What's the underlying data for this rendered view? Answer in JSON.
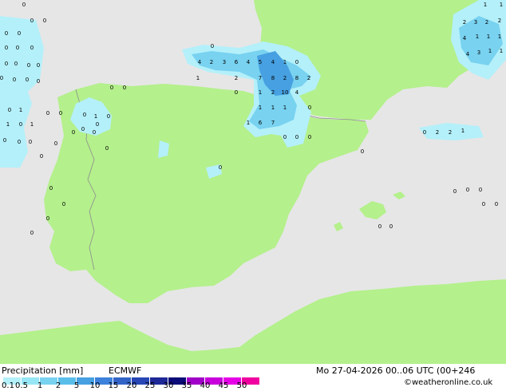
{
  "legend": {
    "title": "Precipitation [mm]",
    "model": "ECMWF",
    "datetime": "Mo 27-04-2026 00..06 UTC (00+246",
    "credit": "©weatheronline.co.uk",
    "ticks": [
      "0.1",
      "0.5",
      "1",
      "2",
      "5",
      "10",
      "15",
      "20",
      "25",
      "30",
      "35",
      "40",
      "45",
      "50"
    ],
    "colors": [
      "#b4f0fa",
      "#96e6f5",
      "#78d2f0",
      "#5abeeb",
      "#46a0e1",
      "#3c82dc",
      "#3264c8",
      "#2846b4",
      "#1e2896",
      "#0a0a78",
      "#a000c8",
      "#c800dc",
      "#e600e6",
      "#f000a0"
    ]
  },
  "map_colors": {
    "sea": "#e6e6e6",
    "land": "#b4f08c",
    "border": "#8c8c8c",
    "precip_light": "#b4f0fa",
    "precip_medium": "#78d2f0",
    "precip_heavy": "#46a0e1"
  },
  "precip_labels": [
    {
      "id": "pl-1",
      "t": "0"
    },
    {
      "id": "pl-2",
      "t": "0"
    },
    {
      "id": "pl-3",
      "t": "0"
    },
    {
      "id": "pl-4",
      "t": "0"
    },
    {
      "id": "pl-5",
      "t": "0"
    },
    {
      "id": "pl-6",
      "t": "0"
    },
    {
      "id": "pl-7",
      "t": "0"
    },
    {
      "id": "pl-8",
      "t": "0"
    },
    {
      "id": "pl-9",
      "t": "0"
    },
    {
      "id": "pl-10",
      "t": "0"
    },
    {
      "id": "pl-11",
      "t": "0"
    },
    {
      "id": "pl-12",
      "t": "0"
    },
    {
      "id": "pl-13",
      "t": "0"
    },
    {
      "id": "pl-14",
      "t": "0"
    },
    {
      "id": "pl-15",
      "t": "0"
    },
    {
      "id": "pl-16",
      "t": "0"
    },
    {
      "id": "pl-17",
      "t": "0"
    },
    {
      "id": "pl-18",
      "t": "0"
    },
    {
      "id": "pl-19",
      "t": "0"
    },
    {
      "id": "pl-20",
      "t": "1"
    },
    {
      "id": "pl-21",
      "t": "0"
    },
    {
      "id": "pl-22",
      "t": "0"
    },
    {
      "id": "pl-23",
      "t": "1"
    },
    {
      "id": "pl-24",
      "t": "0"
    },
    {
      "id": "pl-25",
      "t": "1"
    },
    {
      "id": "pl-26",
      "t": "0"
    },
    {
      "id": "pl-27",
      "t": "0"
    },
    {
      "id": "pl-28",
      "t": "0"
    },
    {
      "id": "pl-29",
      "t": "0"
    },
    {
      "id": "pl-30",
      "t": "0"
    },
    {
      "id": "pl-31",
      "t": "0"
    },
    {
      "id": "pl-32",
      "t": "0"
    },
    {
      "id": "pl-33",
      "t": "0"
    },
    {
      "id": "pl-34",
      "t": "0"
    },
    {
      "id": "pl-35",
      "t": "0"
    },
    {
      "id": "pl-36",
      "t": "1"
    },
    {
      "id": "pl-37",
      "t": "0"
    },
    {
      "id": "pl-38",
      "t": "0"
    },
    {
      "id": "pl-39",
      "t": "0"
    },
    {
      "id": "pl-40",
      "t": "0"
    },
    {
      "id": "pl-41",
      "t": "0"
    },
    {
      "id": "pl-42",
      "t": "0"
    },
    {
      "id": "pl-43",
      "t": "0"
    },
    {
      "id": "pl-44",
      "t": "4"
    },
    {
      "id": "pl-45",
      "t": "2"
    },
    {
      "id": "pl-46",
      "t": "3"
    },
    {
      "id": "pl-47",
      "t": "6"
    },
    {
      "id": "pl-48",
      "t": "4"
    },
    {
      "id": "pl-49",
      "t": "5"
    },
    {
      "id": "pl-50",
      "t": "4"
    },
    {
      "id": "pl-51",
      "t": "1"
    },
    {
      "id": "pl-52",
      "t": "0"
    },
    {
      "id": "pl-53",
      "t": "1"
    },
    {
      "id": "pl-54",
      "t": "2"
    },
    {
      "id": "pl-55",
      "t": "7"
    },
    {
      "id": "pl-56",
      "t": "8"
    },
    {
      "id": "pl-57",
      "t": "2"
    },
    {
      "id": "pl-58",
      "t": "8"
    },
    {
      "id": "pl-59",
      "t": "2"
    },
    {
      "id": "pl-60",
      "t": "0"
    },
    {
      "id": "pl-61",
      "t": "1"
    },
    {
      "id": "pl-62",
      "t": "2"
    },
    {
      "id": "pl-63",
      "t": "10"
    },
    {
      "id": "pl-64",
      "t": "4"
    },
    {
      "id": "pl-65",
      "t": "1"
    },
    {
      "id": "pl-66",
      "t": "1"
    },
    {
      "id": "pl-67",
      "t": "1"
    },
    {
      "id": "pl-68",
      "t": "0"
    },
    {
      "id": "pl-69",
      "t": "1"
    },
    {
      "id": "pl-70",
      "t": "6"
    },
    {
      "id": "pl-71",
      "t": "7"
    },
    {
      "id": "pl-72",
      "t": "0"
    },
    {
      "id": "pl-73",
      "t": "0"
    },
    {
      "id": "pl-74",
      "t": "0"
    },
    {
      "id": "pl-75",
      "t": "0"
    },
    {
      "id": "pl-76",
      "t": "0"
    },
    {
      "id": "pl-77",
      "t": "0"
    },
    {
      "id": "pl-78",
      "t": "2"
    },
    {
      "id": "pl-79",
      "t": "2"
    },
    {
      "id": "pl-80",
      "t": "1"
    },
    {
      "id": "pl-81",
      "t": "0"
    },
    {
      "id": "pl-82",
      "t": "0"
    },
    {
      "id": "pl-83",
      "t": "0"
    },
    {
      "id": "pl-84",
      "t": "0"
    },
    {
      "id": "pl-85",
      "t": "0"
    },
    {
      "id": "pl-86",
      "t": "0"
    },
    {
      "id": "pl-87",
      "t": "0"
    },
    {
      "id": "pl-88",
      "t": "1"
    },
    {
      "id": "pl-89",
      "t": "2"
    },
    {
      "id": "pl-90",
      "t": "3"
    },
    {
      "id": "pl-91",
      "t": "2"
    },
    {
      "id": "pl-92",
      "t": "2"
    },
    {
      "id": "pl-93",
      "t": "4"
    },
    {
      "id": "pl-94",
      "t": "1"
    },
    {
      "id": "pl-95",
      "t": "1"
    },
    {
      "id": "pl-96",
      "t": "1"
    },
    {
      "id": "pl-97",
      "t": "4"
    },
    {
      "id": "pl-98",
      "t": "3"
    },
    {
      "id": "pl-99",
      "t": "1"
    },
    {
      "id": "pl-100",
      "t": "1"
    },
    {
      "id": "pl-101",
      "t": "1"
    }
  ]
}
